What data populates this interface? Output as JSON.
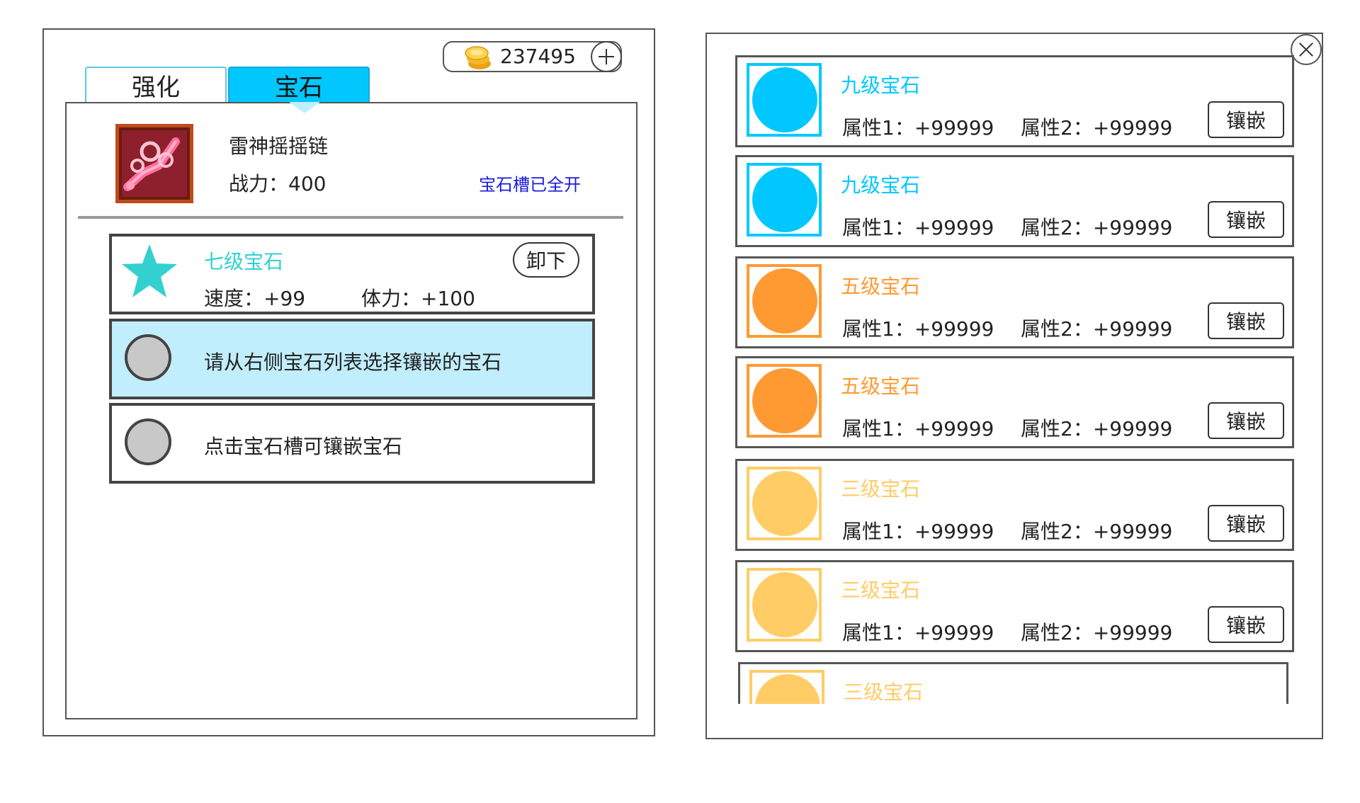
{
  "currency": {
    "amount": "237495"
  },
  "tabs": [
    {
      "label": "强化"
    },
    {
      "label": "宝石"
    }
  ],
  "equipment": {
    "name": "雷神摇摇链",
    "power": "战力：400",
    "slots_status": "宝石槽已全开"
  },
  "slots": [
    {
      "gem_name": "七级宝石",
      "attr_a": "速度：+99",
      "attr_b": "体力：+100",
      "unequip_label": "卸下",
      "star_color": "#33d0d0"
    },
    {
      "hint": "请从右侧宝石列表选择镶嵌的宝石"
    },
    {
      "hint": "点击宝石槽可镶嵌宝石"
    }
  ],
  "gem_list": [
    {
      "name": "九级宝石",
      "attr1": "属性1：+99999",
      "attr2": "属性2：+99999",
      "button": "镶嵌",
      "color": "#00c8ff"
    },
    {
      "name": "九级宝石",
      "attr1": "属性1：+99999",
      "attr2": "属性2：+99999",
      "button": "镶嵌",
      "color": "#00c8ff"
    },
    {
      "name": "五级宝石",
      "attr1": "属性1：+99999",
      "attr2": "属性2：+99999",
      "button": "镶嵌",
      "color": "#ff9a33"
    },
    {
      "name": "五级宝石",
      "attr1": "属性1：+99999",
      "attr2": "属性2：+99999",
      "button": "镶嵌",
      "color": "#ff9a33"
    },
    {
      "name": "三级宝石",
      "attr1": "属性1：+99999",
      "attr2": "属性2：+99999",
      "button": "镶嵌",
      "color": "#ffcc66"
    },
    {
      "name": "三级宝石",
      "attr1": "属性1：+99999",
      "attr2": "属性2：+99999",
      "button": "镶嵌",
      "color": "#ffcc66"
    },
    {
      "name": "三级宝石",
      "attr1": "",
      "attr2": "",
      "button": "",
      "color": "#ffcc66"
    }
  ],
  "icons": {
    "coin": "coin-icon",
    "add": "plus-icon",
    "close": "close-icon",
    "equipment": "chain-weapon-icon",
    "slot_star": "star-icon",
    "empty_slot": "empty-gem-slot-icon"
  }
}
